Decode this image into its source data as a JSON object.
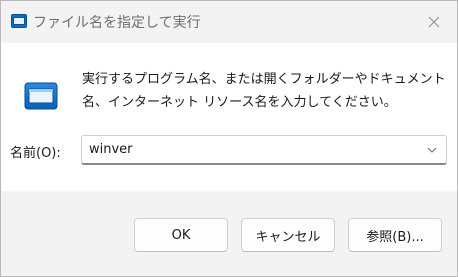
{
  "window": {
    "title": "ファイル名を指定して実行",
    "icon": "run-dialog-icon",
    "close_icon": "close-icon"
  },
  "content": {
    "icon": "run-dialog-icon",
    "description": "実行するプログラム名、または開くフォルダーやドキュメント名、インターネット リソース名を入力してください。",
    "name_label": "名前(O):",
    "name_value": "winver",
    "dropdown_icon": "chevron-down-icon"
  },
  "buttons": {
    "ok": "OK",
    "cancel": "キャンセル",
    "browse": "参照(B)..."
  },
  "colors": {
    "accent": "#0067c0",
    "background": "#f3f3f3",
    "content_background": "#ffffff"
  }
}
